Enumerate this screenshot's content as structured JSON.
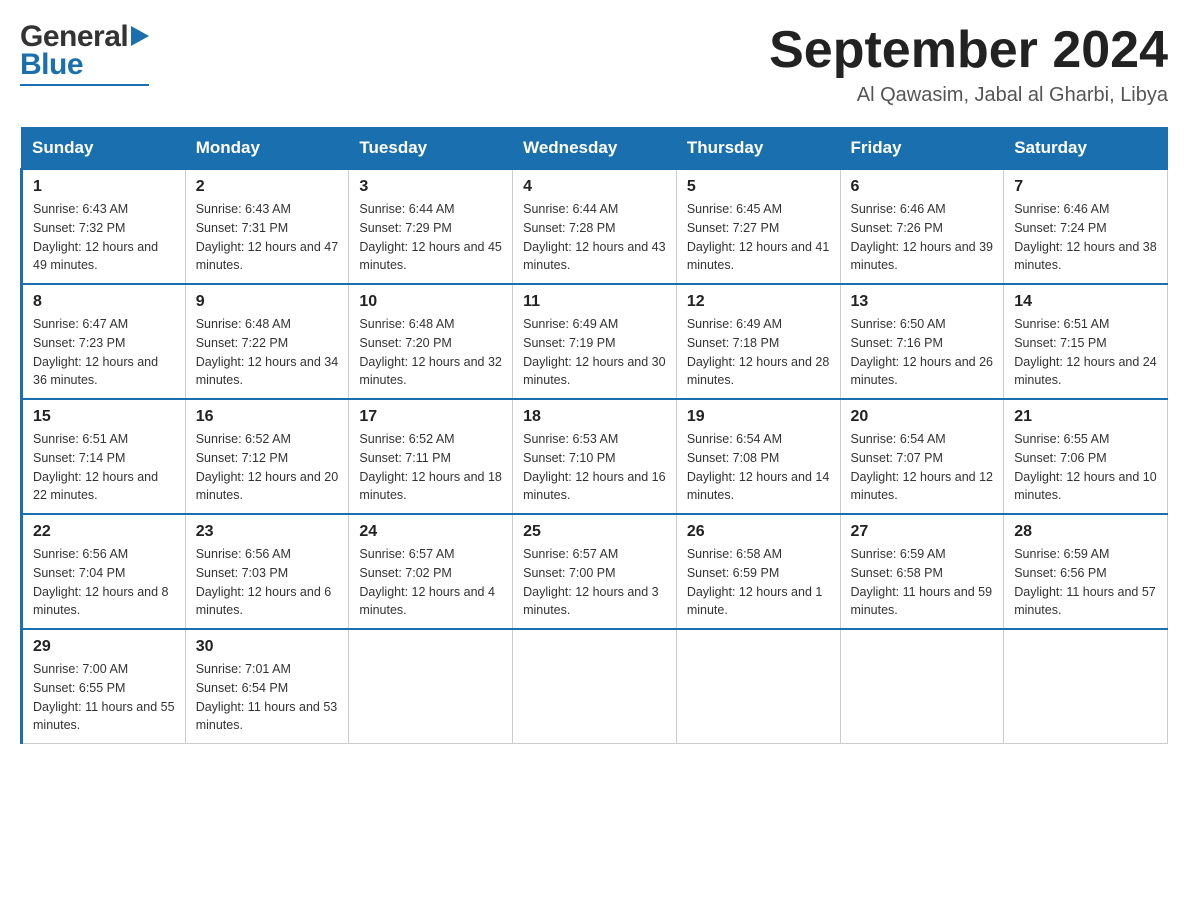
{
  "header": {
    "title": "September 2024",
    "subtitle": "Al Qawasim, Jabal al Gharbi, Libya"
  },
  "weekdays": [
    "Sunday",
    "Monday",
    "Tuesday",
    "Wednesday",
    "Thursday",
    "Friday",
    "Saturday"
  ],
  "weeks": [
    [
      {
        "day": "1",
        "sunrise": "Sunrise: 6:43 AM",
        "sunset": "Sunset: 7:32 PM",
        "daylight": "Daylight: 12 hours and 49 minutes."
      },
      {
        "day": "2",
        "sunrise": "Sunrise: 6:43 AM",
        "sunset": "Sunset: 7:31 PM",
        "daylight": "Daylight: 12 hours and 47 minutes."
      },
      {
        "day": "3",
        "sunrise": "Sunrise: 6:44 AM",
        "sunset": "Sunset: 7:29 PM",
        "daylight": "Daylight: 12 hours and 45 minutes."
      },
      {
        "day": "4",
        "sunrise": "Sunrise: 6:44 AM",
        "sunset": "Sunset: 7:28 PM",
        "daylight": "Daylight: 12 hours and 43 minutes."
      },
      {
        "day": "5",
        "sunrise": "Sunrise: 6:45 AM",
        "sunset": "Sunset: 7:27 PM",
        "daylight": "Daylight: 12 hours and 41 minutes."
      },
      {
        "day": "6",
        "sunrise": "Sunrise: 6:46 AM",
        "sunset": "Sunset: 7:26 PM",
        "daylight": "Daylight: 12 hours and 39 minutes."
      },
      {
        "day": "7",
        "sunrise": "Sunrise: 6:46 AM",
        "sunset": "Sunset: 7:24 PM",
        "daylight": "Daylight: 12 hours and 38 minutes."
      }
    ],
    [
      {
        "day": "8",
        "sunrise": "Sunrise: 6:47 AM",
        "sunset": "Sunset: 7:23 PM",
        "daylight": "Daylight: 12 hours and 36 minutes."
      },
      {
        "day": "9",
        "sunrise": "Sunrise: 6:48 AM",
        "sunset": "Sunset: 7:22 PM",
        "daylight": "Daylight: 12 hours and 34 minutes."
      },
      {
        "day": "10",
        "sunrise": "Sunrise: 6:48 AM",
        "sunset": "Sunset: 7:20 PM",
        "daylight": "Daylight: 12 hours and 32 minutes."
      },
      {
        "day": "11",
        "sunrise": "Sunrise: 6:49 AM",
        "sunset": "Sunset: 7:19 PM",
        "daylight": "Daylight: 12 hours and 30 minutes."
      },
      {
        "day": "12",
        "sunrise": "Sunrise: 6:49 AM",
        "sunset": "Sunset: 7:18 PM",
        "daylight": "Daylight: 12 hours and 28 minutes."
      },
      {
        "day": "13",
        "sunrise": "Sunrise: 6:50 AM",
        "sunset": "Sunset: 7:16 PM",
        "daylight": "Daylight: 12 hours and 26 minutes."
      },
      {
        "day": "14",
        "sunrise": "Sunrise: 6:51 AM",
        "sunset": "Sunset: 7:15 PM",
        "daylight": "Daylight: 12 hours and 24 minutes."
      }
    ],
    [
      {
        "day": "15",
        "sunrise": "Sunrise: 6:51 AM",
        "sunset": "Sunset: 7:14 PM",
        "daylight": "Daylight: 12 hours and 22 minutes."
      },
      {
        "day": "16",
        "sunrise": "Sunrise: 6:52 AM",
        "sunset": "Sunset: 7:12 PM",
        "daylight": "Daylight: 12 hours and 20 minutes."
      },
      {
        "day": "17",
        "sunrise": "Sunrise: 6:52 AM",
        "sunset": "Sunset: 7:11 PM",
        "daylight": "Daylight: 12 hours and 18 minutes."
      },
      {
        "day": "18",
        "sunrise": "Sunrise: 6:53 AM",
        "sunset": "Sunset: 7:10 PM",
        "daylight": "Daylight: 12 hours and 16 minutes."
      },
      {
        "day": "19",
        "sunrise": "Sunrise: 6:54 AM",
        "sunset": "Sunset: 7:08 PM",
        "daylight": "Daylight: 12 hours and 14 minutes."
      },
      {
        "day": "20",
        "sunrise": "Sunrise: 6:54 AM",
        "sunset": "Sunset: 7:07 PM",
        "daylight": "Daylight: 12 hours and 12 minutes."
      },
      {
        "day": "21",
        "sunrise": "Sunrise: 6:55 AM",
        "sunset": "Sunset: 7:06 PM",
        "daylight": "Daylight: 12 hours and 10 minutes."
      }
    ],
    [
      {
        "day": "22",
        "sunrise": "Sunrise: 6:56 AM",
        "sunset": "Sunset: 7:04 PM",
        "daylight": "Daylight: 12 hours and 8 minutes."
      },
      {
        "day": "23",
        "sunrise": "Sunrise: 6:56 AM",
        "sunset": "Sunset: 7:03 PM",
        "daylight": "Daylight: 12 hours and 6 minutes."
      },
      {
        "day": "24",
        "sunrise": "Sunrise: 6:57 AM",
        "sunset": "Sunset: 7:02 PM",
        "daylight": "Daylight: 12 hours and 4 minutes."
      },
      {
        "day": "25",
        "sunrise": "Sunrise: 6:57 AM",
        "sunset": "Sunset: 7:00 PM",
        "daylight": "Daylight: 12 hours and 3 minutes."
      },
      {
        "day": "26",
        "sunrise": "Sunrise: 6:58 AM",
        "sunset": "Sunset: 6:59 PM",
        "daylight": "Daylight: 12 hours and 1 minute."
      },
      {
        "day": "27",
        "sunrise": "Sunrise: 6:59 AM",
        "sunset": "Sunset: 6:58 PM",
        "daylight": "Daylight: 11 hours and 59 minutes."
      },
      {
        "day": "28",
        "sunrise": "Sunrise: 6:59 AM",
        "sunset": "Sunset: 6:56 PM",
        "daylight": "Daylight: 11 hours and 57 minutes."
      }
    ],
    [
      {
        "day": "29",
        "sunrise": "Sunrise: 7:00 AM",
        "sunset": "Sunset: 6:55 PM",
        "daylight": "Daylight: 11 hours and 55 minutes."
      },
      {
        "day": "30",
        "sunrise": "Sunrise: 7:01 AM",
        "sunset": "Sunset: 6:54 PM",
        "daylight": "Daylight: 11 hours and 53 minutes."
      },
      null,
      null,
      null,
      null,
      null
    ]
  ]
}
